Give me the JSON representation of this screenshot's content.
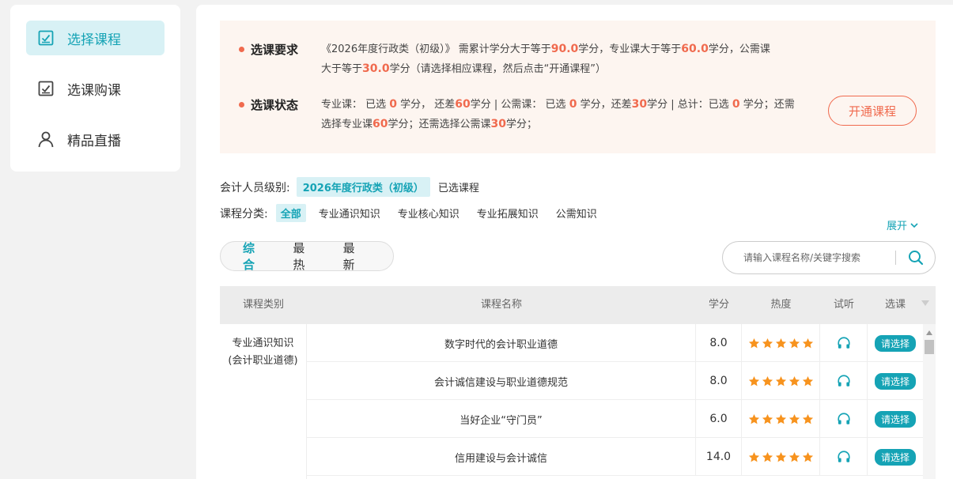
{
  "sidebar": {
    "items": [
      {
        "label": "选择课程",
        "icon": "checkbox-icon",
        "active": true
      },
      {
        "label": "选课购课",
        "icon": "checkbox-icon",
        "active": false
      },
      {
        "label": "精品直播",
        "icon": "user-icon",
        "active": false
      }
    ]
  },
  "notice": {
    "requirement_title": "选课要求",
    "requirement": {
      "p1": "《2026年度行政类（初级）》 需累计学分大于等于",
      "total": "90.0",
      "p2": "学分，专业课大于等于",
      "major": "60.0",
      "p3": "学分，公需课",
      "p4": "大于等于",
      "public": "30.0",
      "p5": "学分（请选择相应课程，然后点击“开通课程”）"
    },
    "status_title": "选课状态",
    "status": {
      "p1": "专业课： 已选 ",
      "major_selected": "0",
      "p2": " 学分， 还差",
      "major_remaining": "60",
      "p3": "学分 | 公需课： 已选 ",
      "public_selected": "0",
      "p4": " 学分，还差",
      "public_remaining": "30",
      "p5": "学分 | 总计：已选 ",
      "total_selected": "0",
      "p6": " 学分；还需",
      "p7": "选择专业课",
      "need_major": "60",
      "p8": "学分；还需选择公需课",
      "need_public": "30",
      "p9": "学分；"
    },
    "open_button": "开通课程"
  },
  "filters": {
    "level_label": "会计人员级别:",
    "level_value": "2026年度行政类（初级）",
    "selected_courses": "已选课程",
    "category_label": "课程分类:",
    "categories": [
      "全部",
      "专业通识知识",
      "专业核心知识",
      "专业拓展知识",
      "公需知识"
    ],
    "expand": "展开"
  },
  "sort": {
    "options": [
      "综合",
      "最热",
      "最新"
    ]
  },
  "search": {
    "placeholder": "请输入课程名称/关键字搜索"
  },
  "table": {
    "headers": {
      "type": "课程类别",
      "name": "课程名称",
      "credit": "学分",
      "heat": "热度",
      "listen": "试听",
      "select": "选课"
    },
    "type_cell_line1": "专业通识知识",
    "type_cell_line2": "(会计职业道德)",
    "select_label": "请选择",
    "rows": [
      {
        "name": "数字时代的会计职业道德",
        "credit": "8.0",
        "stars": 5
      },
      {
        "name": "会计诚信建设与职业道德规范",
        "credit": "8.0",
        "stars": 5
      },
      {
        "name": "当好企业“守门员”",
        "credit": "6.0",
        "stars": 5
      },
      {
        "name": "信用建设与会计诚信",
        "credit": "14.0",
        "stars": 5
      }
    ]
  },
  "colors": {
    "accent": "#15a3b5",
    "highlight": "#f06a4e",
    "star": "#f7931e"
  }
}
